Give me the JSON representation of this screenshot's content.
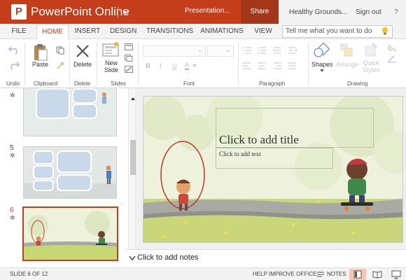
{
  "app": {
    "logo_letter": "P",
    "name": "PowerPoint Online",
    "document_name": "Presentation...",
    "share_label": "Share",
    "user_name": "Healthy Grounds...",
    "sign_out_label": "Sign out",
    "help_label": "?",
    "brand_color": "#c43e1c"
  },
  "tabs": [
    {
      "label": "FILE",
      "active": false
    },
    {
      "label": "HOME",
      "active": true
    },
    {
      "label": "INSERT",
      "active": false
    },
    {
      "label": "DESIGN",
      "active": false
    },
    {
      "label": "TRANSITIONS",
      "active": false
    },
    {
      "label": "ANIMATIONS",
      "active": false
    },
    {
      "label": "VIEW",
      "active": false
    }
  ],
  "tell_me": {
    "placeholder": "Tell me what you want to do",
    "icon": "lightbulb-icon"
  },
  "ribbon": {
    "groups": {
      "undo": "Undo",
      "clipboard": "Clipboard",
      "delete": "Delete",
      "slides": "Slides",
      "font": "Font",
      "paragraph": "Paragraph",
      "drawing": "Drawing"
    },
    "buttons": {
      "paste": "Paste",
      "delete": "Delete",
      "new_slide": "New Slide",
      "shapes": "Shapes",
      "arrange": "Arrange",
      "quick_styles": "Quick Styles"
    },
    "font_buttons": [
      "B",
      "I",
      "U",
      "A"
    ]
  },
  "thumbnails": {
    "items": [
      {
        "number": "",
        "selected": false
      },
      {
        "number": "5",
        "selected": false
      },
      {
        "number": "6",
        "selected": true
      }
    ],
    "transition_icon": "star-icon"
  },
  "slide": {
    "title_placeholder": "Click to add title",
    "text_placeholder": "Click to add text",
    "background_color": "#eef2dc",
    "ground_color": "#c7d774"
  },
  "notes": {
    "placeholder": "Click to add notes"
  },
  "status": {
    "slide_info": "SLIDE 6 OF 12",
    "help_improve": "HELP IMPROVE OFFICE",
    "notes_label": "NOTES"
  }
}
